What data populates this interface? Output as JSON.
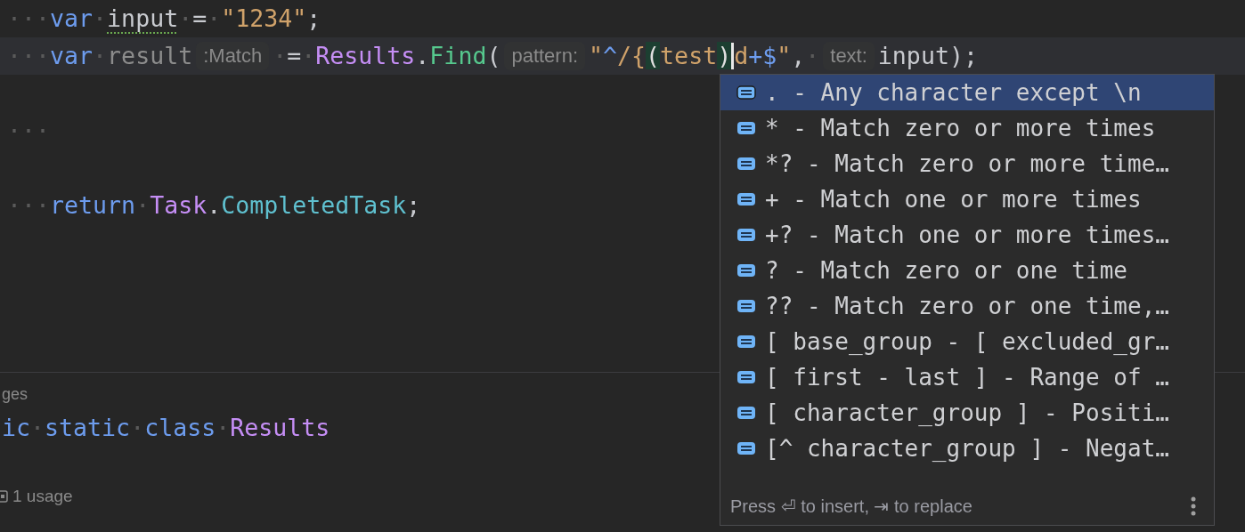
{
  "editor": {
    "lines": [
      {
        "current": false,
        "segments": [
          {
            "kind": "code",
            "tokens": [
              {
                "t": "···",
                "kind": "ws"
              },
              {
                "t": "var",
                "kind": "keyword"
              },
              {
                "t": "·",
                "kind": "ws"
              },
              {
                "t": "input",
                "kind": "weak"
              },
              {
                "t": "·",
                "kind": "ws"
              },
              {
                "t": "=",
                "kind": "punct"
              },
              {
                "t": "·",
                "kind": "ws"
              },
              {
                "t": "\"1234\"",
                "kind": "string"
              },
              {
                "t": ";",
                "kind": "punct"
              }
            ]
          }
        ]
      },
      {
        "current": true,
        "segments": [
          {
            "kind": "code",
            "tokens": [
              {
                "t": "···",
                "kind": "ws"
              },
              {
                "t": "var",
                "kind": "keyword"
              },
              {
                "t": "·",
                "kind": "ws"
              },
              {
                "t": "result",
                "kind": "unused"
              }
            ]
          },
          {
            "kind": "hint",
            "text": ":Match"
          },
          {
            "kind": "code",
            "tokens": [
              {
                "t": "·",
                "kind": "ws"
              },
              {
                "t": "=",
                "kind": "punct"
              },
              {
                "t": "·",
                "kind": "ws"
              },
              {
                "t": "Results",
                "kind": "type"
              },
              {
                "t": ".",
                "kind": "punct"
              },
              {
                "t": "Find",
                "kind": "method"
              },
              {
                "t": "(",
                "kind": "punct"
              }
            ]
          },
          {
            "kind": "hint",
            "text": "pattern:"
          },
          {
            "kind": "code",
            "tokens": [
              {
                "t": "\"",
                "kind": "string"
              },
              {
                "t": "^",
                "kind": "regex"
              },
              {
                "t": "/{",
                "kind": "string"
              },
              {
                "t": "(",
                "kind": "bracket"
              },
              {
                "t": "test",
                "kind": "string"
              },
              {
                "t": ")",
                "kind": "bracket"
              }
            ]
          },
          {
            "kind": "caret"
          },
          {
            "kind": "code",
            "tokens": [
              {
                "t": "d",
                "kind": "string"
              },
              {
                "t": "+$",
                "kind": "regex"
              },
              {
                "t": "\"",
                "kind": "string"
              },
              {
                "t": ",",
                "kind": "punct"
              },
              {
                "t": "·",
                "kind": "ws"
              }
            ]
          },
          {
            "kind": "hint",
            "text": "text:"
          },
          {
            "kind": "code",
            "tokens": [
              {
                "t": "input);",
                "kind": "punct"
              }
            ]
          }
        ]
      },
      {
        "current": false
      },
      {
        "current": false,
        "segments": [
          {
            "kind": "code",
            "tokens": [
              {
                "t": "···",
                "kind": "ws"
              }
            ]
          }
        ]
      },
      {
        "current": false
      },
      {
        "current": false,
        "segments": [
          {
            "kind": "code",
            "tokens": [
              {
                "t": "···",
                "kind": "ws"
              },
              {
                "t": "return",
                "kind": "keyword"
              },
              {
                "t": "·",
                "kind": "ws"
              },
              {
                "t": "Task",
                "kind": "type"
              },
              {
                "t": ".",
                "kind": "punct"
              },
              {
                "t": "CompletedTask",
                "kind": "field"
              },
              {
                "t": ";",
                "kind": "punct"
              }
            ]
          }
        ]
      },
      {
        "current": false
      }
    ]
  },
  "lower": {
    "usages_label": "ges",
    "code": [
      {
        "t": "ic",
        "kind": "keyword"
      },
      {
        "t": "·",
        "kind": "ws"
      },
      {
        "t": "static",
        "kind": "keyword"
      },
      {
        "t": "·",
        "kind": "ws"
      },
      {
        "t": "class",
        "kind": "keyword"
      },
      {
        "t": "·",
        "kind": "ws"
      },
      {
        "t": "Results",
        "kind": "type"
      }
    ],
    "usage": "1 usage"
  },
  "completion": {
    "items": [
      {
        "text": ". - Any character except \\n",
        "selected": true
      },
      {
        "text": "* - Match zero or more times",
        "selected": false
      },
      {
        "text": "*? - Match zero or more time…",
        "selected": false
      },
      {
        "text": "+ - Match one or more times",
        "selected": false
      },
      {
        "text": "+? - Match one or more times…",
        "selected": false
      },
      {
        "text": "? - Match zero or one time",
        "selected": false
      },
      {
        "text": "?? - Match zero or one time,…",
        "selected": false
      },
      {
        "text": "[ base_group - [ excluded_gr…",
        "selected": false
      },
      {
        "text": "[ first - last ] - Range of …",
        "selected": false
      },
      {
        "text": "[ character_group ] - Positi…",
        "selected": false
      },
      {
        "text": "[^ character_group ] - Negat…",
        "selected": false
      }
    ],
    "footer": "Press ⏎ to insert, ⇥ to replace"
  }
}
